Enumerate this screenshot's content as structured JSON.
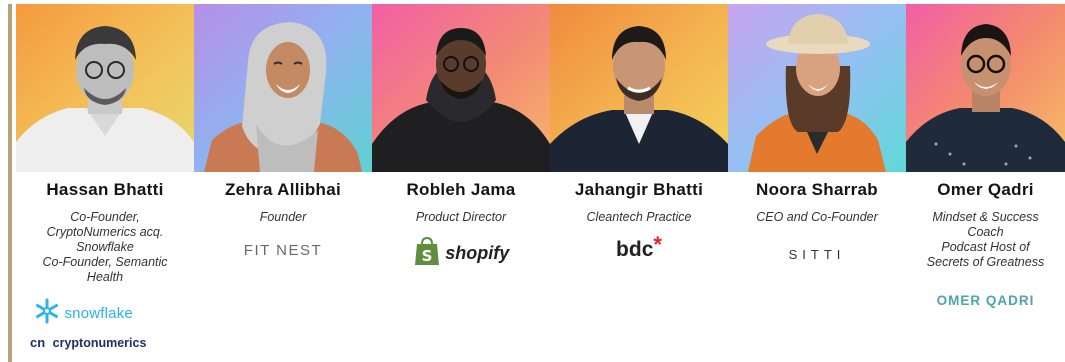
{
  "speakers": [
    {
      "name": "Hassan Bhatti",
      "role": "Co-Founder,\nCryptoNumerics acq.\nSnowflake\nCo-Founder, Semantic\nHealth",
      "logos": [
        "snowflake",
        "cryptonumerics"
      ]
    },
    {
      "name": "Zehra Allibhai",
      "role": "Founder",
      "logos": [
        "FIT NEST"
      ]
    },
    {
      "name": "Robleh Jama",
      "role": "Product Director",
      "logos": [
        "shopify"
      ]
    },
    {
      "name": "Jahangir Bhatti",
      "role": "Cleantech Practice",
      "logos": [
        "bdc"
      ]
    },
    {
      "name": "Noora Sharrab",
      "role": "CEO and Co-Founder",
      "logos": [
        "SITTI"
      ]
    },
    {
      "name": "Omer Qadri",
      "role": "Mindset & Success\nCoach\nPodcast Host of\nSecrets of Greatness",
      "logos": [
        "OMER QADRI"
      ]
    }
  ],
  "colors": {
    "bdc_star": "#e4202e",
    "shopify_green": "#5e8e3e",
    "snowflake_blue": "#29b5e8",
    "cryptonumerics_navy": "#1f2f6b",
    "omer_qadri_teal": "#4fa3ad"
  }
}
